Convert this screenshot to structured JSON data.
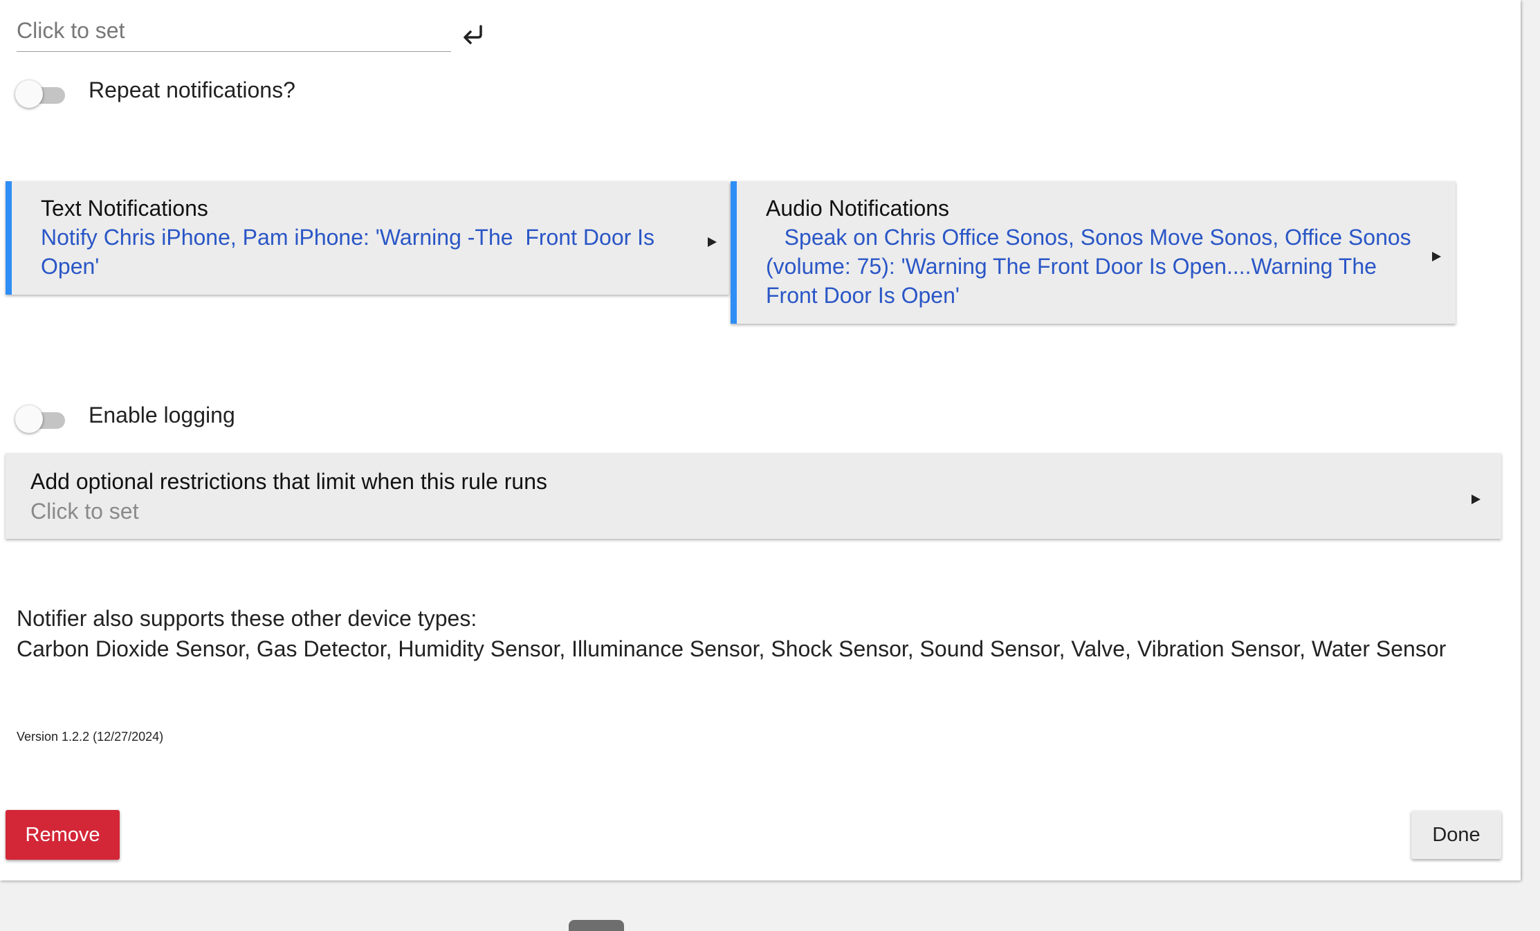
{
  "top_input": {
    "placeholder": "Click to set",
    "value": "",
    "enter_icon": "enter-return-icon"
  },
  "repeat_notifications": {
    "label": "Repeat notifications?",
    "on": false
  },
  "cards": [
    {
      "title": "Text Notifications",
      "description": "Notify Chris iPhone, Pam iPhone: 'Warning -The  Front Door Is Open'",
      "icon": "arrow-right-icon"
    },
    {
      "title": "Audio Notifications",
      "description": "   Speak on Chris Office Sonos, Sonos Move Sonos, Office Sonos (volume: 75): 'Warning The Front Door Is Open....Warning The Front Door Is Open'",
      "icon": "arrow-right-icon"
    }
  ],
  "enable_logging": {
    "label": "Enable logging",
    "on": false
  },
  "restrictions": {
    "title": "Add optional restrictions that limit when this rule runs",
    "subtitle": "Click to set",
    "icon": "arrow-right-icon"
  },
  "supports": {
    "heading": "Notifier also supports these other device types:",
    "list": "Carbon Dioxide Sensor, Gas Detector, Humidity Sensor, Illuminance Sensor, Shock Sensor, Sound Sensor, Valve, Vibration Sensor, Water Sensor"
  },
  "version": "Version 1.2.2 (12/27/2024)",
  "buttons": {
    "remove": "Remove",
    "done": "Done"
  },
  "colors": {
    "card_accent": "#2f8ef5",
    "link_text": "#2a56c6",
    "remove_button": "#d32738"
  }
}
